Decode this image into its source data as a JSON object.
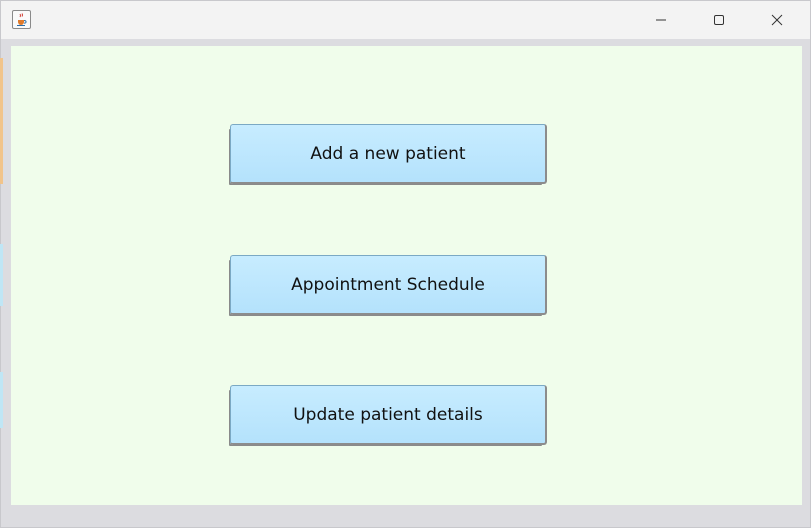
{
  "window": {
    "controls": {
      "minimize_icon": "minimize-icon",
      "maximize_icon": "maximize-icon",
      "close_icon": "close-icon"
    },
    "app_icon": "java-cup-icon"
  },
  "main": {
    "buttons": [
      {
        "label": "Add a new patient"
      },
      {
        "label": "Appointment Schedule"
      },
      {
        "label": "Update patient details"
      }
    ]
  },
  "colors": {
    "content_background": "#f0fdeb",
    "button_background": "#c0e9ff",
    "titlebar": "#f3f3f3"
  }
}
